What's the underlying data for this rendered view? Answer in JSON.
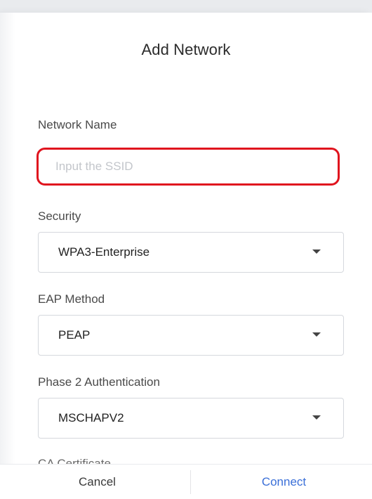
{
  "dialog": {
    "title": "Add Network"
  },
  "fields": {
    "network_name": {
      "label": "Network Name",
      "value": "",
      "placeholder": "Input the SSID"
    },
    "security": {
      "label": "Security",
      "value": "WPA3-Enterprise"
    },
    "eap_method": {
      "label": "EAP Method",
      "value": "PEAP"
    },
    "phase2": {
      "label": "Phase 2 Authentication",
      "value": "MSCHAPV2"
    },
    "ca_certificate": {
      "label": "CA Certificate"
    }
  },
  "footer": {
    "cancel_label": "Cancel",
    "connect_label": "Connect"
  },
  "colors": {
    "highlight_border": "#e0141e",
    "connect_text": "#3a6fd8"
  },
  "icons": {
    "dropdown": "caret-down-icon"
  }
}
